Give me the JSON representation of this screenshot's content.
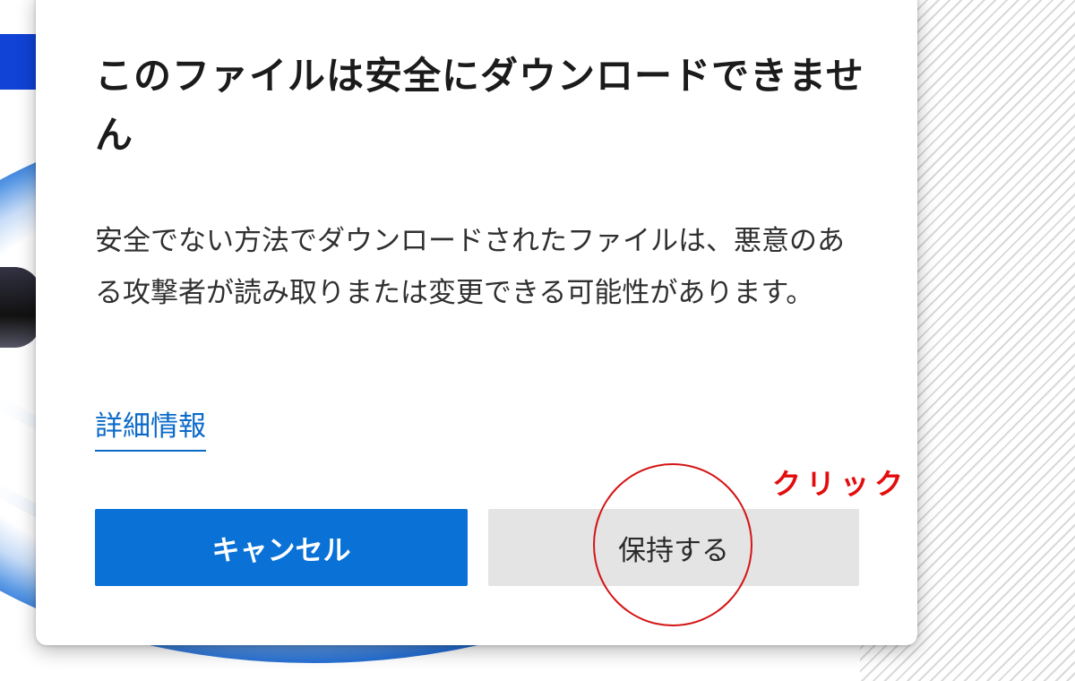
{
  "dialog": {
    "title": "このファイルは安全にダウンロードできません",
    "message": "安全でない方法でダウンロードされたファイルは、悪意のある攻撃者が読み取りまたは変更できる可能性があります。",
    "learn_more_link": "詳細情報",
    "cancel_label": "キャンセル",
    "keep_label": "保持する"
  },
  "annotation": {
    "label": "クリック",
    "color": "#e30d0d"
  },
  "colors": {
    "primary_button": "#0a72d6",
    "secondary_button": "#e4e4e4",
    "link": "#0b6ac8"
  }
}
